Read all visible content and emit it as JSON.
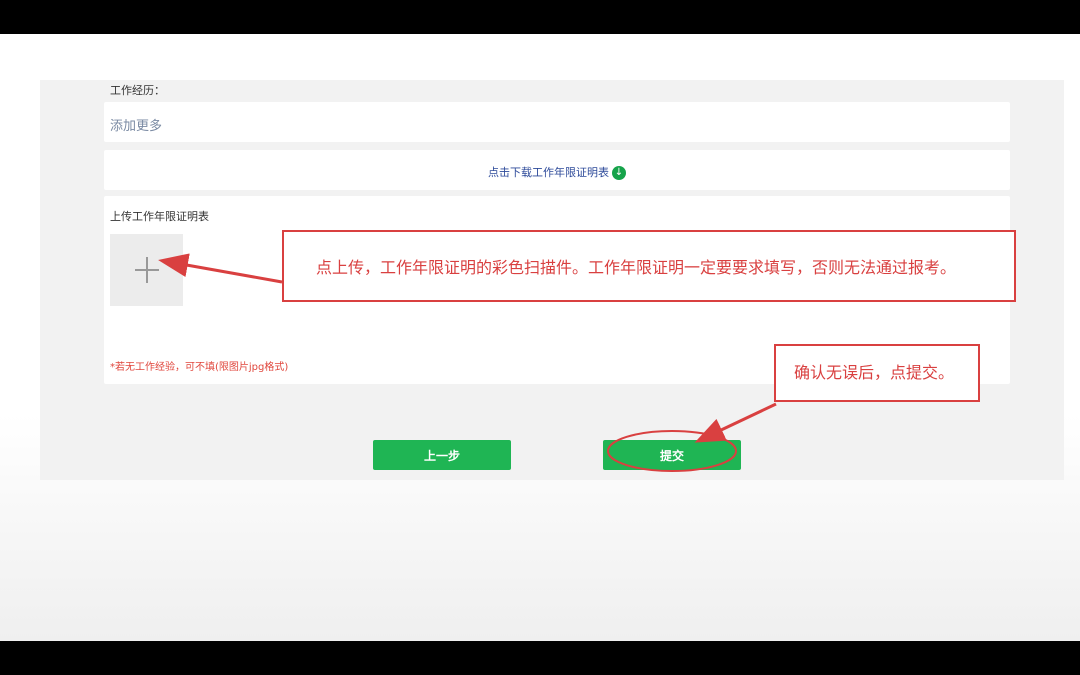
{
  "form": {
    "work_history_label": "工作经历：",
    "add_more_text": "添加更多",
    "download_link_text": "点击下载工作年限证明表",
    "download_icon": "download-icon",
    "upload_section_label": "上传工作年限证明表",
    "upload_icon": "plus-icon",
    "note_text": "*若无工作经验，可不填(限图片jpg格式)",
    "prev_button": "上一步",
    "submit_button": "提交"
  },
  "annotations": {
    "upload_hint": "点上传，工作年限证明的彩色扫描件。工作年限证明一定要要求填写，否则无法通过报考。",
    "submit_hint": "确认无误后，点提交。",
    "color": "#d94040"
  },
  "colors": {
    "accent_green": "#1fb554",
    "note_red": "#e0463c"
  }
}
